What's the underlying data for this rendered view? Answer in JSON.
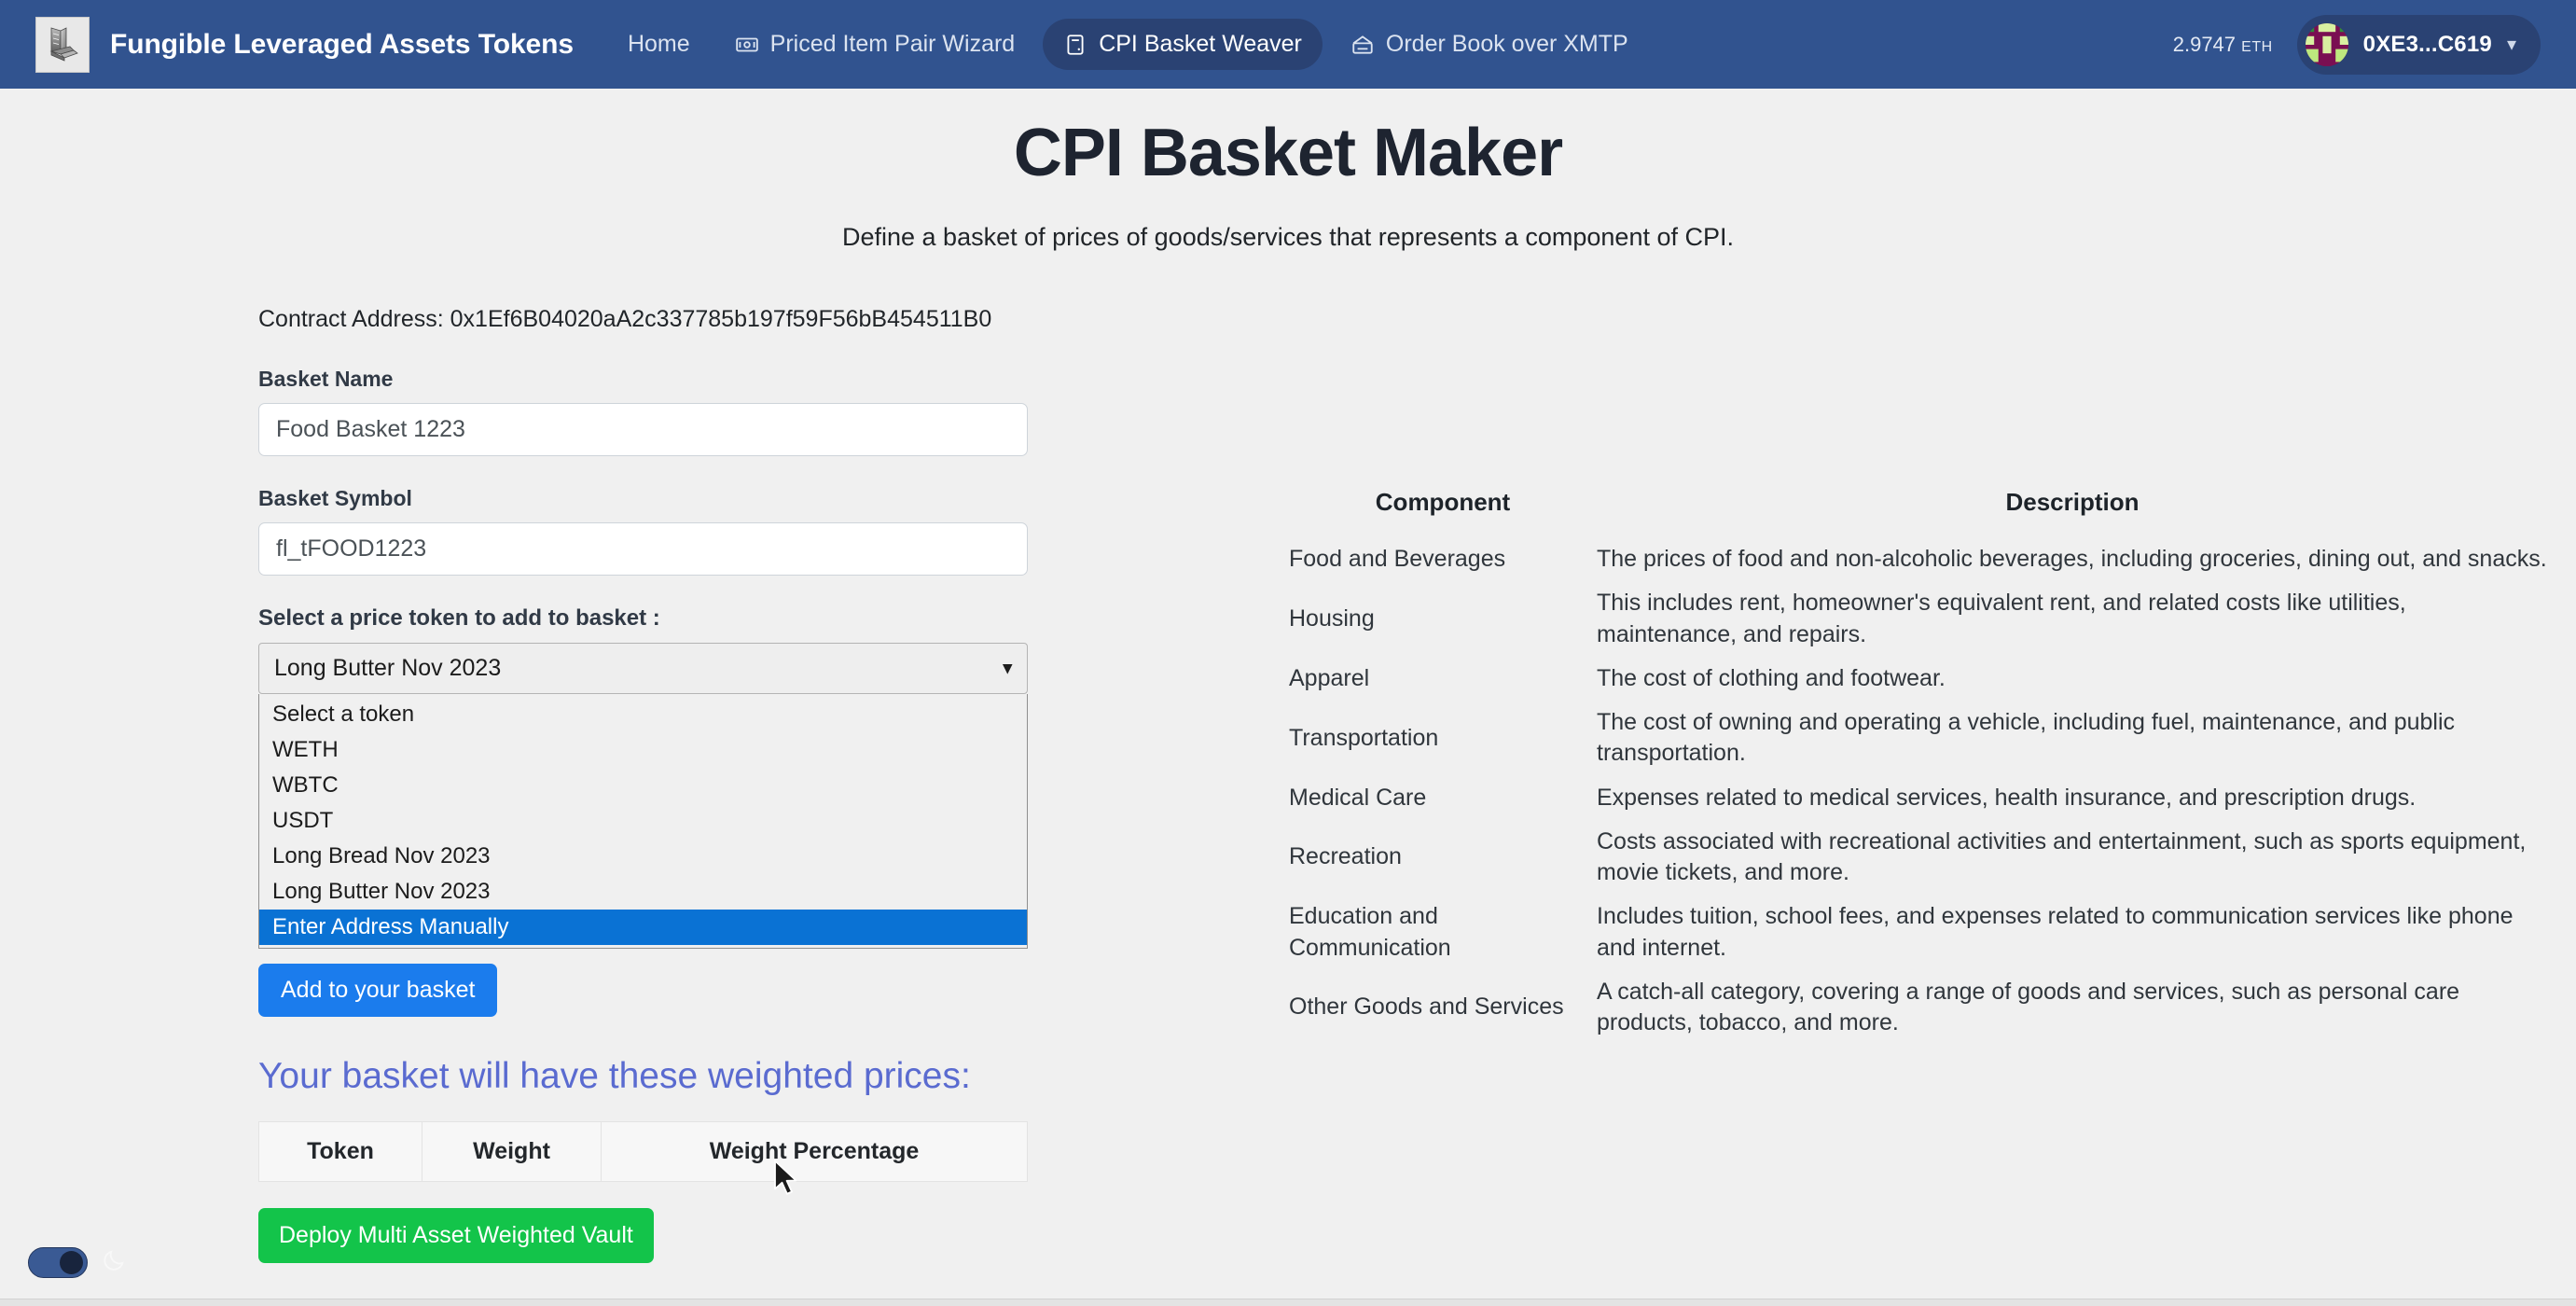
{
  "navbar": {
    "logo_icon": "cube-stack-logo-icon",
    "brand": "Fungible Leveraged Assets Tokens",
    "links": [
      {
        "label": "Home",
        "icon": null,
        "active": false
      },
      {
        "label": "Priced Item Pair Wizard",
        "icon": "banknote-icon",
        "active": false
      },
      {
        "label": "CPI Basket Weaver",
        "icon": "clipboard-icon",
        "active": true
      },
      {
        "label": "Order Book over XMTP",
        "icon": "envelope-icon",
        "active": false
      }
    ],
    "balance_value": "2.9747",
    "balance_unit": "ETH",
    "wallet_address": "0XE3...C619",
    "wallet_caret_icon": "chevron-down-icon",
    "avatar_icon": "blockie-avatar"
  },
  "header": {
    "title": "CPI Basket Maker",
    "subtitle": "Define a basket of prices of goods/services that represents a component of CPI."
  },
  "form": {
    "contract_address_line": "Contract Address: 0x1Ef6B04020aA2c337785b197f59F56bB454511B0",
    "basket_name_label": "Basket Name",
    "basket_name_value": "Food Basket 1223",
    "basket_symbol_label": "Basket Symbol",
    "basket_symbol_value": "fl_tFOOD1223",
    "select_label": "Select a price token to add to basket :",
    "select_value": "Long Butter Nov 2023",
    "select_caret_icon": "chevron-down-icon",
    "options": [
      {
        "label": "Select a token",
        "selected": false
      },
      {
        "label": "WETH",
        "selected": false
      },
      {
        "label": "WBTC",
        "selected": false
      },
      {
        "label": "USDT",
        "selected": false
      },
      {
        "label": "Long Bread Nov 2023",
        "selected": false
      },
      {
        "label": "Long Butter Nov 2023",
        "selected": false
      },
      {
        "label": "Enter Address Manually",
        "selected": true
      }
    ],
    "add_button": "Add to your basket",
    "basket_heading": "Your basket will have these weighted prices:",
    "weight_table_headers": [
      "Token",
      "Weight",
      "Weight Percentage"
    ],
    "weight_table_rows": [],
    "deploy_button": "Deploy Multi Asset Weighted Vault"
  },
  "cpi_table": {
    "headers": [
      "Component",
      "Description"
    ],
    "rows": [
      {
        "component": "Food and Beverages",
        "description": "The prices of food and non-alcoholic beverages, including groceries, dining out, and snacks."
      },
      {
        "component": "Housing",
        "description": "This includes rent, homeowner's equivalent rent, and related costs like utilities, maintenance, and repairs."
      },
      {
        "component": "Apparel",
        "description": "The cost of clothing and footwear."
      },
      {
        "component": "Transportation",
        "description": "The cost of owning and operating a vehicle, including fuel, maintenance, and public transportation."
      },
      {
        "component": "Medical Care",
        "description": "Expenses related to medical services, health insurance, and prescription drugs."
      },
      {
        "component": "Recreation",
        "description": "Costs associated with recreational activities and entertainment, such as sports equipment, movie tickets, and more."
      },
      {
        "component": "Education and Communication",
        "description": "Includes tuition, school fees, and expenses related to communication services like phone and internet."
      },
      {
        "component": "Other Goods and Services",
        "description": "A catch-all category, covering a range of goods and services, such as personal care products, tobacco, and more."
      }
    ]
  },
  "dark_mode_toggle": {
    "state": "on",
    "icon": "moon-icon"
  },
  "colors": {
    "navbar": "#31538f",
    "page_bg": "#f0f0f0",
    "accent_blue": "#1b7ced",
    "option_highlight": "#0a72d4",
    "deploy_green": "#13c44a",
    "heading_blue": "#5a6bd0"
  }
}
